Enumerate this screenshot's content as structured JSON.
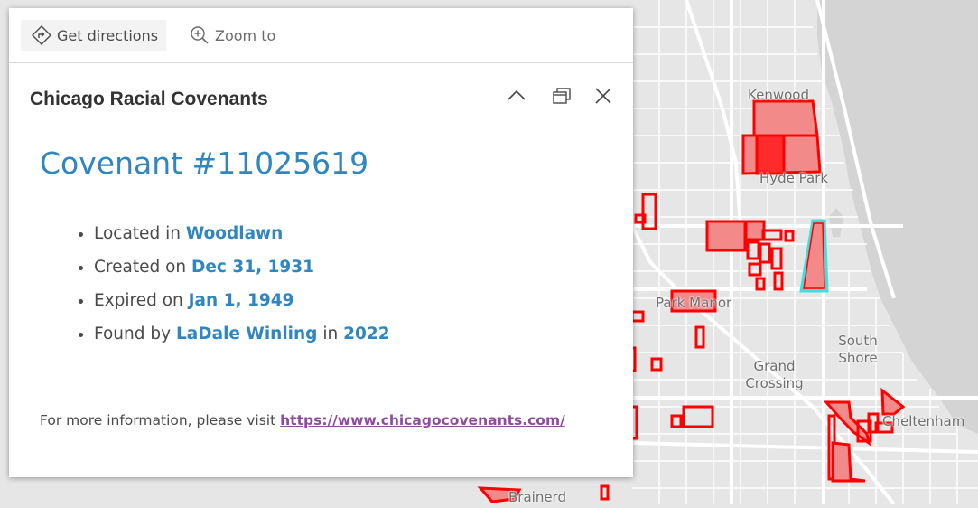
{
  "map": {
    "labels": {
      "kenwood": "Kenwood",
      "hyde_park": "Hyde Park",
      "park_manor": "Park Manor",
      "south_shore": "South Shore",
      "grand_crossing": "Grand Crossing",
      "cheltenham": "Cheltenham",
      "brainerd": "Brainerd"
    },
    "colors": {
      "water": "#d4d4d4",
      "land": "#e6e6e6",
      "road": "#ffffff",
      "covenant_fill": "#f38a8a",
      "covenant_outline": "#ff0000",
      "selected_outline": "#3de0e0"
    }
  },
  "popup": {
    "toolbar": {
      "directions_label": "Get directions",
      "zoom_label": "Zoom to"
    },
    "title": "Chicago Racial Covenants",
    "heading": "Covenant #11025619",
    "facts": {
      "located_prefix": "Located in",
      "neighborhood": "Woodlawn",
      "created_prefix": "Created on",
      "created": "Dec 31, 1931",
      "expired_prefix": "Expired on",
      "expired": "Jan 1, 1949",
      "found_prefix": "Found by",
      "finder": "LaDale Winling",
      "in_word": "in",
      "year": "2022"
    },
    "more_info_text": "For more information, please visit",
    "more_info_link": "https://www.chicagocovenants.com/"
  },
  "icons": {
    "directions": "directions-icon",
    "zoom": "zoom-in-icon",
    "collapse": "chevron-up-icon",
    "dock": "dock-icon",
    "close": "close-icon"
  }
}
